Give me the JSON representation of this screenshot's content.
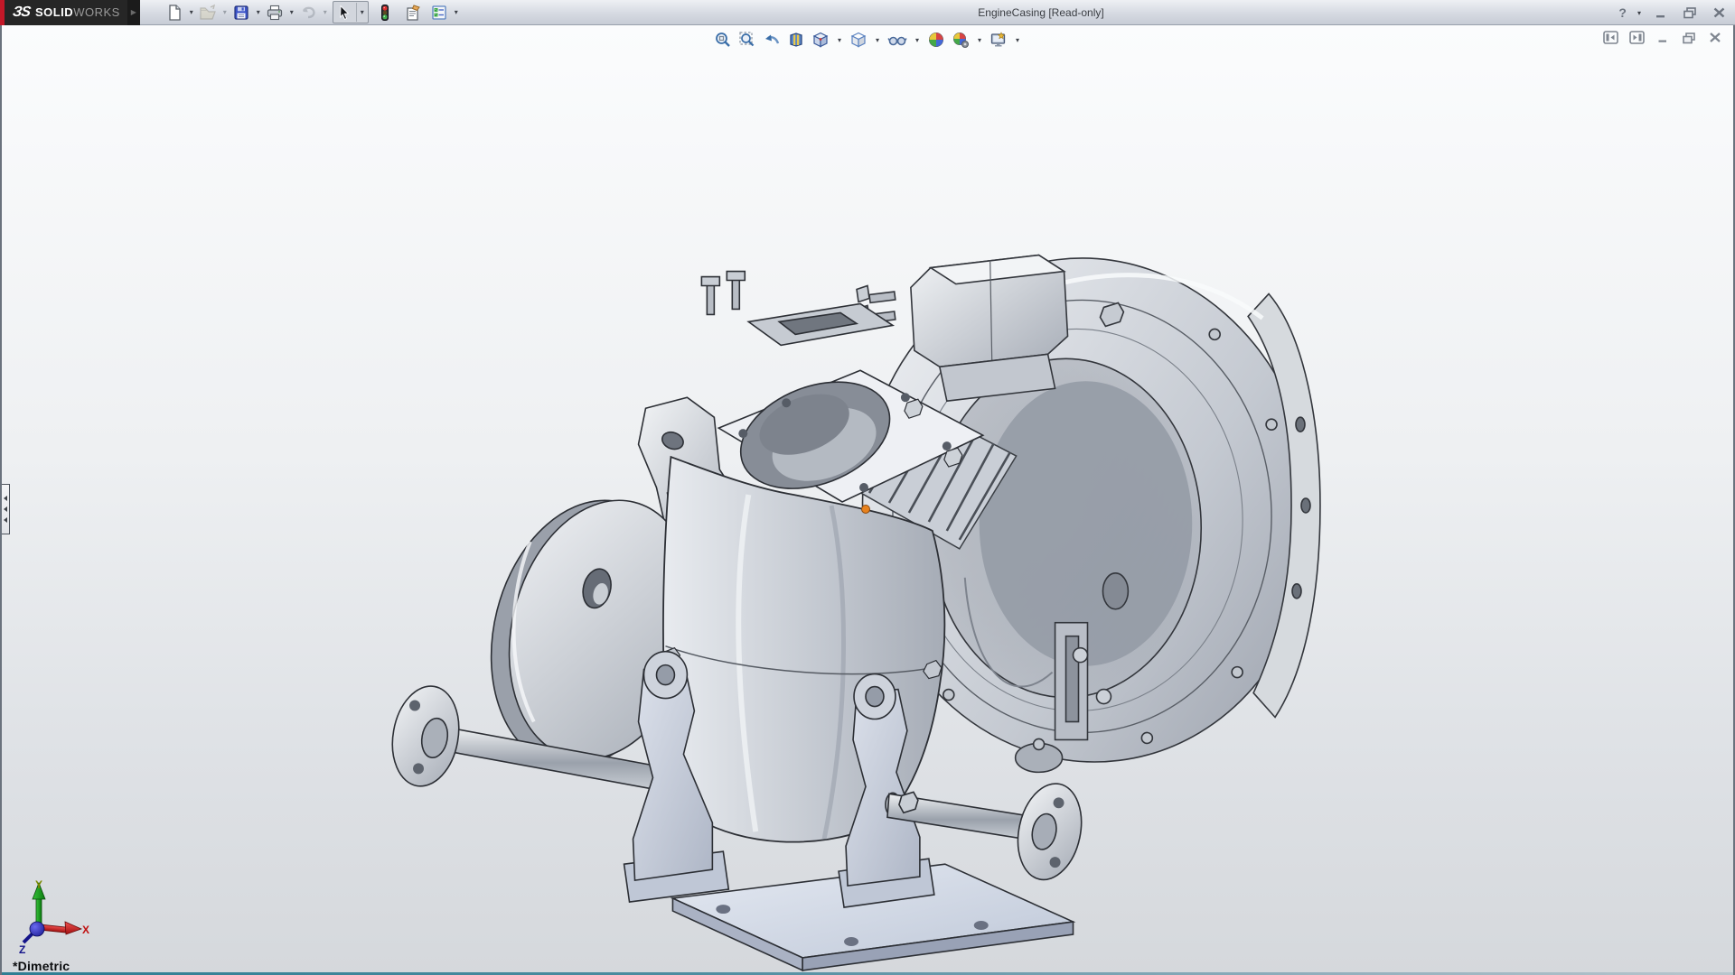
{
  "window": {
    "title": "EngineCasing [Read-only]",
    "brand": {
      "mark": "ЗS",
      "name_bold": "SOLID",
      "name_light": "WORKS",
      "flyout": "▶"
    },
    "controls": {
      "help": "?"
    }
  },
  "glyphs": {
    "caret": "▾"
  },
  "main_toolbar": {
    "buttons": [
      {
        "icon": "new-document-icon",
        "dropdown": true,
        "disabled": false
      },
      {
        "icon": "open-icon",
        "dropdown": true,
        "disabled": true
      },
      {
        "icon": "save-icon",
        "dropdown": true,
        "disabled": false
      },
      {
        "icon": "print-icon",
        "dropdown": true,
        "disabled": false
      },
      {
        "icon": "undo-icon",
        "dropdown": true,
        "disabled": true
      },
      {
        "icon": "select-cursor-icon",
        "dropdown": true,
        "disabled": false,
        "pressed": true
      },
      {
        "icon": "traffic-light-icon",
        "dropdown": false,
        "disabled": false
      },
      {
        "icon": "file-properties-icon",
        "dropdown": false,
        "disabled": false
      },
      {
        "icon": "options-icon",
        "dropdown": true,
        "disabled": false
      }
    ]
  },
  "heads_up_toolbar": {
    "buttons": [
      {
        "icon": "zoom-to-fit-icon",
        "dropdown": false
      },
      {
        "icon": "zoom-to-area-icon",
        "dropdown": false
      },
      {
        "icon": "previous-view-icon",
        "dropdown": false
      },
      {
        "icon": "section-view-icon",
        "dropdown": false
      },
      {
        "icon": "view-orientation-icon",
        "dropdown": true
      },
      {
        "icon": "display-style-icon",
        "dropdown": true
      },
      {
        "icon": "hide-show-items-icon",
        "dropdown": true
      },
      {
        "icon": "edit-appearance-icon",
        "dropdown": false
      },
      {
        "icon": "apply-scene-icon",
        "dropdown": true
      },
      {
        "icon": "view-settings-icon",
        "dropdown": true
      }
    ]
  },
  "viewport": {
    "view_name": "*Dimetric",
    "document": "EngineCasing",
    "triad": {
      "x": "X",
      "y": "Y",
      "z": "Z"
    },
    "origin_marker_color": "#e8821e"
  },
  "colors": {
    "titlebar_top": "#eef0f4",
    "titlebar_bottom": "#c7ccd6",
    "logo_bg": "#262626",
    "logo_red": "#c41828",
    "viewport_top": "#fbfcfd",
    "viewport_bottom": "#d5d8dc",
    "bottom_edge": "#2f7e93",
    "triad_x": "#cc1111",
    "triad_y": "#0f8a0f",
    "triad_z": "#1c1c9c"
  }
}
